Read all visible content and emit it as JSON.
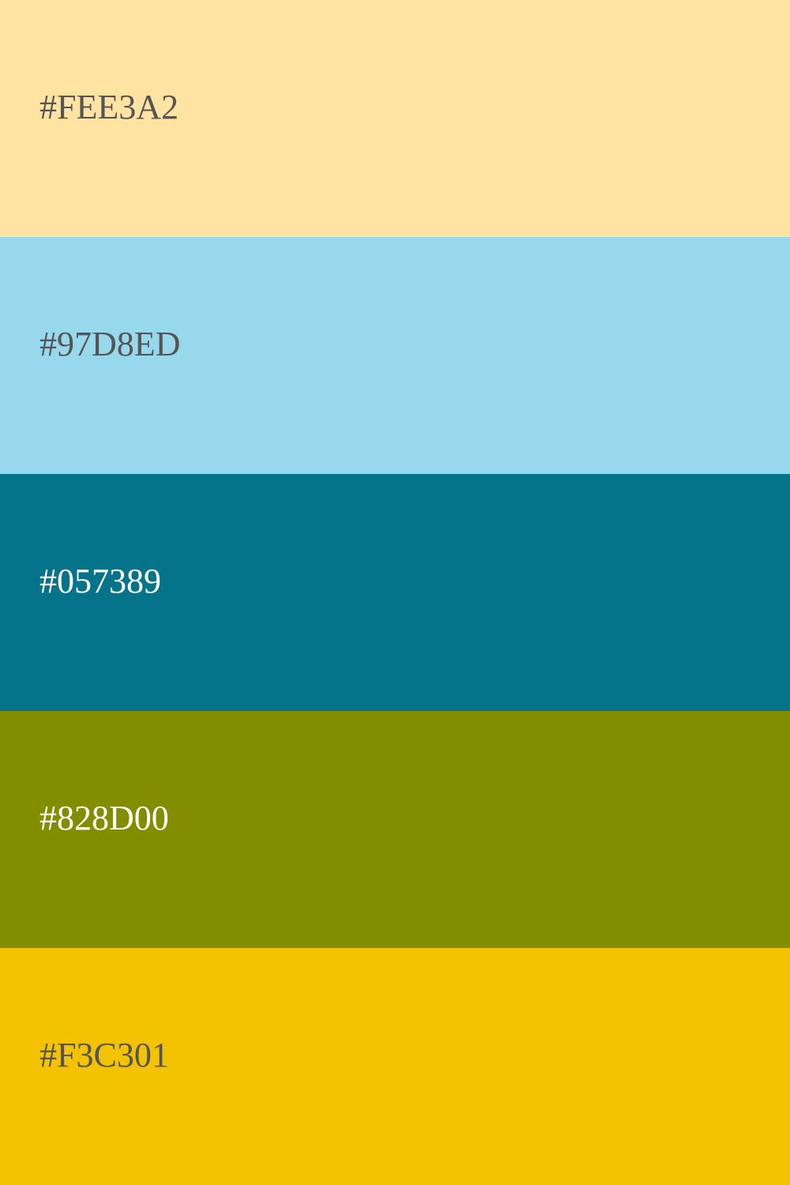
{
  "palette": {
    "swatches": [
      {
        "label": "#FEE3A2",
        "color": "#FEE3A2",
        "text_color": "#555555"
      },
      {
        "label": "#97D8ED",
        "color": "#97D8ED",
        "text_color": "#555555"
      },
      {
        "label": "#057389",
        "color": "#057389",
        "text_color": "#FFFFFF"
      },
      {
        "label": "#828D00",
        "color": "#828D00",
        "text_color": "#FFFFFF"
      },
      {
        "label": "#F3C301",
        "color": "#F3C301",
        "text_color": "#555555"
      }
    ]
  }
}
